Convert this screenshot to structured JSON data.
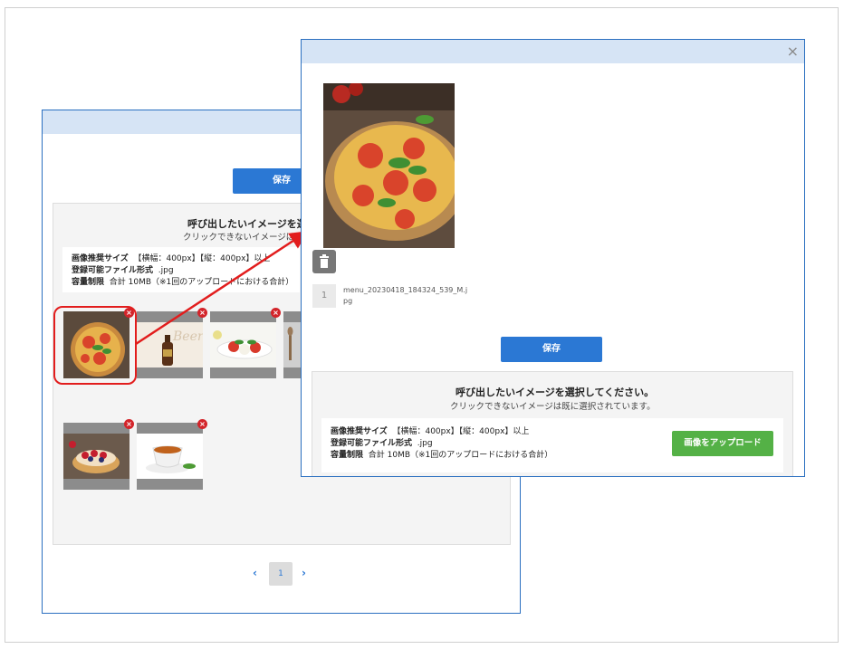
{
  "back_window": {
    "save_label": "保存",
    "panel": {
      "title": "呼び出したいイメージを選",
      "subtitle": "クリックできないイメージは既"
    },
    "info": {
      "size_label": "画像推奨サイズ",
      "size_value": "【横幅：400px】【縦：400px】以上",
      "format_label": "登録可能ファイル形式",
      "format_value": ".jpg",
      "limit_label": "容量制限",
      "limit_value": "合計 10MB（※1回のアップロードにおける合計）"
    },
    "thumbnails": [
      {
        "name": "pizza",
        "delete_icon": "×"
      },
      {
        "name": "beer",
        "delete_icon": "×"
      },
      {
        "name": "caprese",
        "delete_icon": "×"
      },
      {
        "name": "utensils",
        "delete_icon": "×"
      },
      {
        "name": "tart",
        "delete_icon": "×"
      },
      {
        "name": "tea",
        "delete_icon": "×"
      }
    ],
    "pagination": {
      "prev": "‹",
      "page": "1",
      "next": "›"
    }
  },
  "front_window": {
    "close_label": "×",
    "file_index": "1",
    "file_name": "menu_20230418_184324_539_M.jpg",
    "save_label": "保存",
    "panel": {
      "title": "呼び出したいイメージを選択してください。",
      "subtitle": "クリックできないイメージは既に選択されています。"
    },
    "info": {
      "size_label": "画像推奨サイズ",
      "size_value": "【横幅：400px】【縦：400px】以上",
      "format_label": "登録可能ファイル形式",
      "format_value": ".jpg",
      "limit_label": "容量制限",
      "limit_value": "合計 10MB（※1回のアップロードにおける合計）"
    },
    "upload_label": "画像をアップロード"
  },
  "colors": {
    "header": "#d6e4f5",
    "primary": "#2b78d4",
    "upload": "#54b146",
    "delete": "#d3242a",
    "highlight": "#e21d1d"
  }
}
